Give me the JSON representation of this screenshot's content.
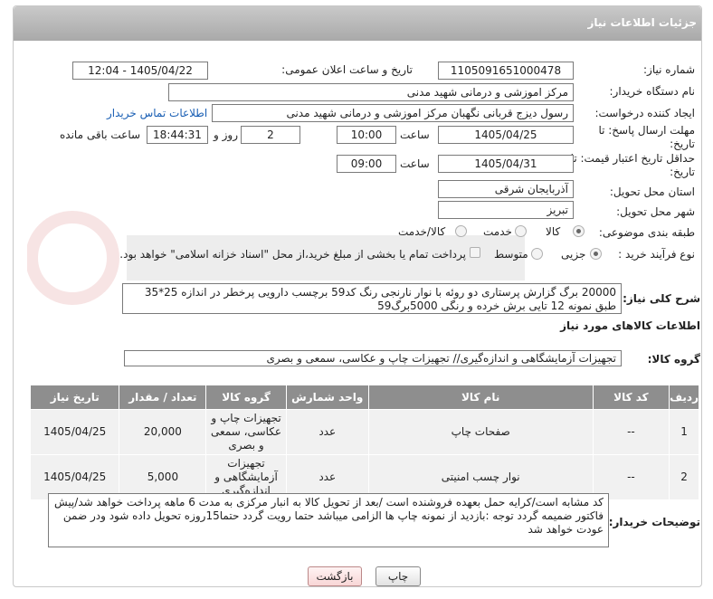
{
  "header": {
    "title": "جزئیات اطلاعات نیاز"
  },
  "form": {
    "need_number_label": "شماره نیاز:",
    "need_number": "1105091651000478",
    "announce_label": "تاریخ و ساعت اعلان عمومی:",
    "announce_value": "1405/04/22 - 12:04",
    "buyer_org_label": "نام دستگاه خریدار:",
    "buyer_org": "مرکز اموزشی و درمانی شهید مدنی",
    "creator_label": "ایجاد کننده درخواست:",
    "creator": "رسول دیزج قربانی نگهبان مرکز اموزشی و درمانی شهید مدنی",
    "contact_link": "اطلاعات تماس خریدار",
    "deadline_label": "مهلت ارسال پاسخ: تا تاریخ:",
    "deadline_date": "1405/04/25",
    "time_label": "ساعت",
    "deadline_time": "10:00",
    "days_value": "2",
    "days_label": "روز و",
    "remaining_time": "18:44:31",
    "remaining_label": "ساعت باقی مانده",
    "validity_label": "حداقل تاریخ اعتبار قیمت: تا تاریخ:",
    "validity_date": "1405/04/31",
    "validity_time": "09:00",
    "province_label": "استان محل تحویل:",
    "province": "آذربایجان شرقی",
    "city_label": "شهر محل تحویل:",
    "city": "تبریز",
    "category_label": "طبقه بندی موضوعی:",
    "category_options": [
      "کالا",
      "خدمت",
      "کالا/خدمت"
    ],
    "category_selected": "کالا",
    "process_label": "نوع فرآیند خرید :",
    "process_options": [
      "جزیی",
      "متوسط"
    ],
    "process_selected": "جزیی",
    "payment_note": "پرداخت تمام یا بخشی از مبلغ خرید،از محل \"اسناد خزانه اسلامی\" خواهد بود."
  },
  "description": {
    "label": "شرح کلی نیاز:",
    "text": "20000 برگ گزارش پرستاری دو روئه با نوار نارنجی رنگ کد59 برچسب دارویی پرخطر در اندازه 25*35 طبق نمونه 12 تایی برش خرده و رنگی 5000برگ59"
  },
  "goods": {
    "section_title": "اطلاعات کالاهای مورد نیاز",
    "group_label": "گروه کالا:",
    "group_value": "تجهیزات آزمایشگاهی و اندازه‌گیری// تجهیزات چاپ و عکاسی، سمعی و بصری",
    "columns": [
      "ردیف",
      "کد کالا",
      "نام کالا",
      "واحد شمارش",
      "گروه کالا",
      "تعداد / مقدار",
      "تاریخ نیاز"
    ],
    "rows": [
      {
        "row": "1",
        "code": "--",
        "name": "صفحات چاپ",
        "unit": "عدد",
        "group": "تجهیزات چاپ و عکاسی، سمعی و بصری",
        "qty": "20,000",
        "date": "1405/04/25"
      },
      {
        "row": "2",
        "code": "--",
        "name": "نوار چسب امنیتی",
        "unit": "عدد",
        "group": "تجهیزات آزمایشگاهی و اندازه‌گیری",
        "qty": "5,000",
        "date": "1405/04/25"
      }
    ]
  },
  "buyer_notes": {
    "label": "توضیحات خریدار:",
    "text": "کد مشابه است/کرایه حمل بعهده فروشنده است /بعد از تحویل کالا به انبار مرکزی به مدت 6 ماهه پرداخت خواهد شد/پیش فاکتور ضمیمه گردد توجه :بازدید از نمونه چاپ ها الزامی میباشد حتما رویت گردد حتما15روزه تحویل داده شود ودر ضمن عودت خواهد شد"
  },
  "buttons": {
    "print": "چاپ",
    "back": "بازگشت"
  },
  "colors": {
    "header": "#b0b0b0",
    "table_header": "#8e8e8e",
    "link": "#1a5fb4",
    "back_button_bg": "#fde4e4"
  }
}
